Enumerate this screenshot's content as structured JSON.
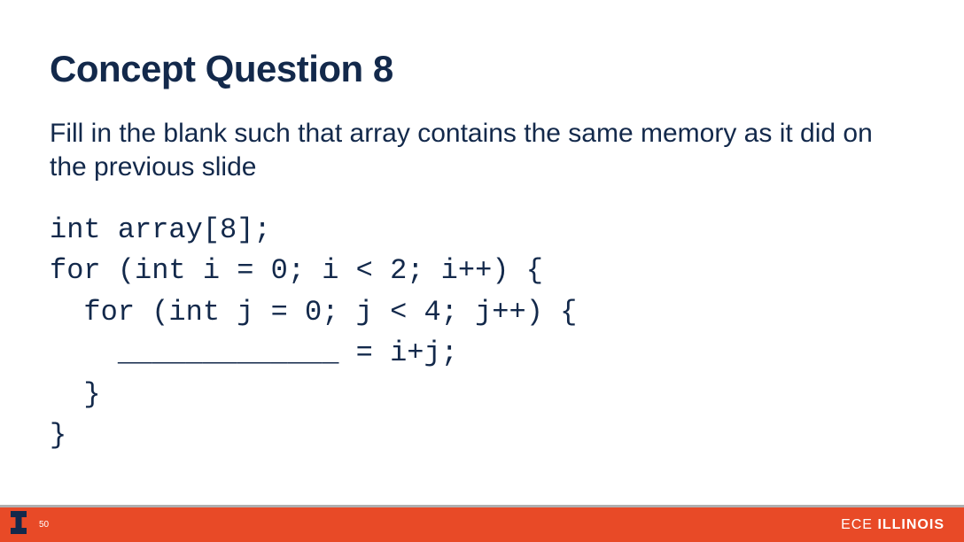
{
  "title": "Concept Question 8",
  "prompt": "Fill in the blank such that array contains the same memory as it did on the previous slide",
  "code": "int array[8];\nfor (int i = 0; i < 2; i++) {\n  for (int j = 0; j < 4; j++) {\n    _____________ = i+j;\n  }\n}",
  "footer": {
    "slide_number": "50",
    "dept": "ECE",
    "school": "ILLINOIS"
  },
  "colors": {
    "navy": "#13294b",
    "orange": "#e84a27"
  }
}
